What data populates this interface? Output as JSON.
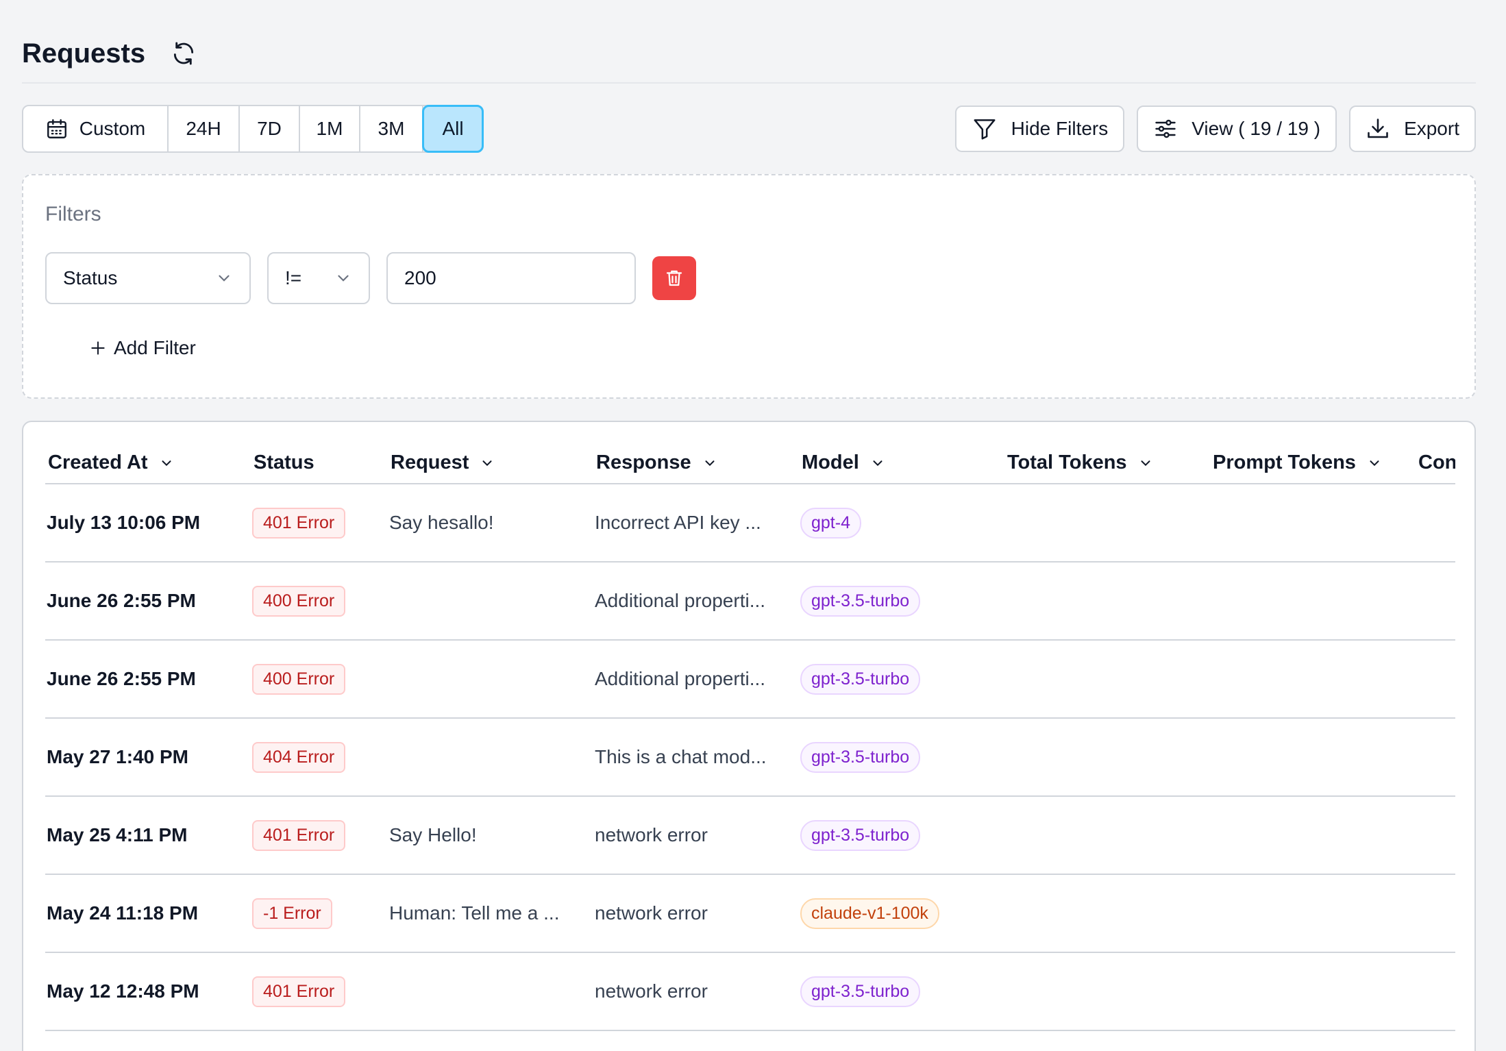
{
  "page": {
    "title": "Requests"
  },
  "time_range": {
    "custom_label": "Custom",
    "options": [
      "24H",
      "7D",
      "1M",
      "3M",
      "All"
    ],
    "selected": "All"
  },
  "actions": {
    "hide_filters": "Hide Filters",
    "view": "View ( 19 / 19 )",
    "export": "Export"
  },
  "filters": {
    "label": "Filters",
    "field": "Status",
    "operator": "!=",
    "value": "200",
    "add_label": "Add Filter"
  },
  "table": {
    "columns": [
      "Created At",
      "Status",
      "Request",
      "Response",
      "Model",
      "Total Tokens",
      "Prompt Tokens",
      "Con"
    ],
    "rows": [
      {
        "created_at": "July 13 10:06 PM",
        "status": "401 Error",
        "request": "Say hesallo!",
        "response": "Incorrect API key ...",
        "model": "gpt-4"
      },
      {
        "created_at": "June 26 2:55 PM",
        "status": "400 Error",
        "request": "",
        "response": "Additional properti...",
        "model": "gpt-3.5-turbo"
      },
      {
        "created_at": "June 26 2:55 PM",
        "status": "400 Error",
        "request": "",
        "response": "Additional properti...",
        "model": "gpt-3.5-turbo"
      },
      {
        "created_at": "May 27 1:40 PM",
        "status": "404 Error",
        "request": "",
        "response": "This is a chat mod...",
        "model": "gpt-3.5-turbo"
      },
      {
        "created_at": "May 25 4:11 PM",
        "status": "401 Error",
        "request": "Say Hello!",
        "response": "network error",
        "model": "gpt-3.5-turbo"
      },
      {
        "created_at": "May 24 11:18 PM",
        "status": "-1 Error",
        "request": "Human: Tell me a ...",
        "response": "network error",
        "model": "claude-v1-100k"
      },
      {
        "created_at": "May 12 12:48 PM",
        "status": "401 Error",
        "request": "",
        "response": "network error",
        "model": "gpt-3.5-turbo"
      }
    ]
  },
  "colors": {
    "accent": "#38bdf8",
    "danger": "#ef4444",
    "model_default": "#7e22ce",
    "model_claude": "#c2410c"
  }
}
